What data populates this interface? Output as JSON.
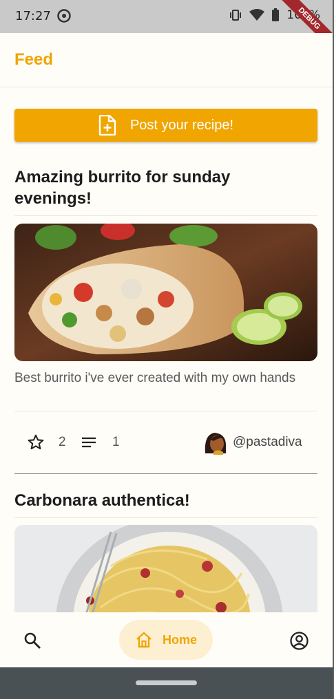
{
  "status_bar": {
    "time": "17:27",
    "battery": "100%",
    "debug_banner": "DEBUG"
  },
  "app_bar": {
    "title": "Feed"
  },
  "post_button": {
    "label": "Post your recipe!"
  },
  "feed": [
    {
      "title": "Amazing burrito for sunday evenings!",
      "description": "Best burrito i've ever created with my own hands",
      "stars": "2",
      "comments": "1",
      "author": "@pastadiva"
    },
    {
      "title": "Carbonara authentica!"
    }
  ],
  "bottom_nav": {
    "home_label": "Home",
    "icons": [
      "search-icon",
      "home-icon",
      "account-icon"
    ]
  },
  "colors": {
    "accent": "#f0a500",
    "accent_light": "#fdf0d2",
    "background": "#fffdf8"
  }
}
